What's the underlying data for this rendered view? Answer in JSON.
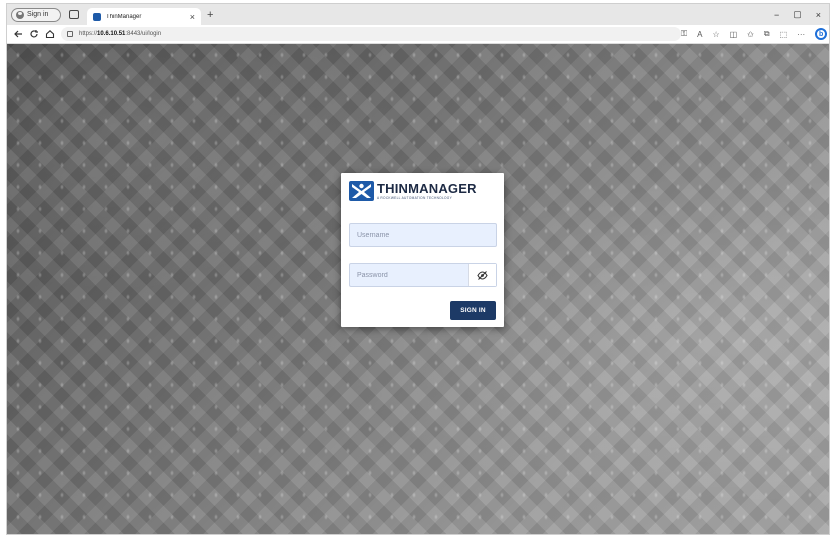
{
  "browser": {
    "profile_label": "Sign in",
    "tab_title": "ThinManager",
    "tab_close": "×",
    "new_tab": "+",
    "url_scheme": "https://",
    "url_host": "10.6.10.51",
    "url_path": ":8443/ui/login",
    "window_controls": {
      "minimize": "−",
      "maximize": "▢",
      "close": "×"
    },
    "more_menu": "···"
  },
  "login": {
    "brand": "THINMANAGER",
    "brand_tagline": "A ROCKWELL AUTOMATION TECHNOLOGY",
    "username_placeholder": "Username",
    "password_placeholder": "Password",
    "sign_in_label": "SIGN IN"
  },
  "colors": {
    "brand_navy": "#1d3a66",
    "input_bg": "#e8f0fe",
    "logo_blue": "#1e5aa8"
  }
}
